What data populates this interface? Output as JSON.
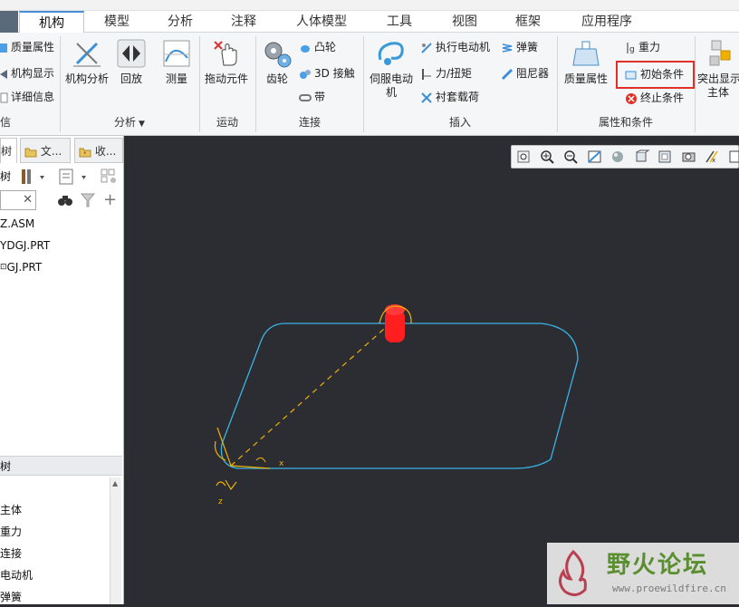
{
  "tabs": [
    {
      "label": "机构",
      "active": true
    },
    {
      "label": "模型"
    },
    {
      "label": "分析"
    },
    {
      "label": "注释"
    },
    {
      "label": "人体模型"
    },
    {
      "label": "工具"
    },
    {
      "label": "视图"
    },
    {
      "label": "框架"
    },
    {
      "label": "应用程序"
    }
  ],
  "ribbon": {
    "info": {
      "items": [
        "质量属性",
        "机构显示",
        "详细信息"
      ],
      "label": "信息"
    },
    "analysis": {
      "buttons": [
        "机构分析",
        "回放",
        "测量"
      ],
      "label": "分析",
      "dropdown_icon": "chevron-down-icon"
    },
    "motion": {
      "buttons": [
        "拖动元件"
      ],
      "label": "运动"
    },
    "connect": {
      "big": "齿轮",
      "items": [
        "凸轮",
        "3D 接触",
        "带"
      ],
      "label": "连接"
    },
    "insert": {
      "big_line1": "伺服电动",
      "big_line2": "机",
      "col1": [
        "执行电动机",
        "力/扭矩",
        "衬套载荷"
      ],
      "col2": [
        "弹簧",
        "阻尼器"
      ],
      "label": "插入"
    },
    "properties": {
      "big": "质量属性",
      "items": [
        "重力",
        "初始条件",
        "终止条件"
      ],
      "label": "属性和条件"
    },
    "extra": {
      "line1": "突出显示",
      "line2": "主体"
    }
  },
  "leftpanel": {
    "tabs": [
      "树",
      "文...",
      "收..."
    ],
    "tree_label": "树",
    "search_placeholder": "",
    "model_items": [
      "Z.ASM",
      "YDGJ.PRT",
      "GJ.PRT"
    ],
    "mech_section": "树",
    "mech_items": [
      "",
      "主体",
      "重力",
      "连接",
      "电动机",
      "弹簧"
    ]
  },
  "viewport": {
    "axis_labels": [
      "x",
      "z"
    ]
  },
  "watermark": {
    "title": "野火论坛",
    "url": "www.proewildfire.cn"
  },
  "colors": {
    "accent_tab": "#4a8fd6",
    "highlight_box": "#e0302a",
    "path_curve": "#3ab4e6",
    "marker": "#ff1f1f",
    "axis": "#f0b000",
    "viewport_bg": "#2b2d33"
  }
}
